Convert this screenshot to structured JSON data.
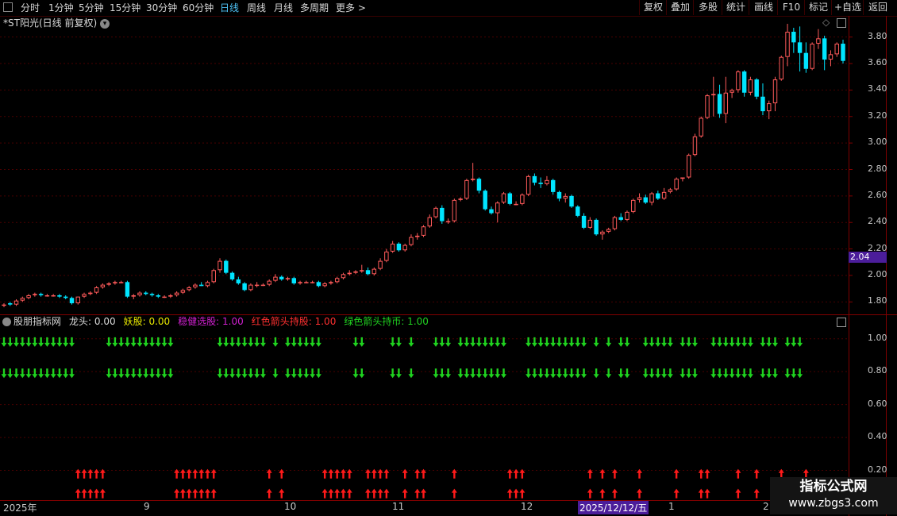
{
  "toolbar": {
    "periods": [
      "分时",
      "1分钟",
      "5分钟",
      "15分钟",
      "30分钟",
      "60分钟",
      "日线",
      "周线",
      "月线",
      "多周期",
      "更多 >"
    ],
    "active_period": "日线",
    "right_buttons": [
      "复权",
      "叠加",
      "多股",
      "统计",
      "画线",
      "F10",
      "标记",
      "+自选",
      "返回"
    ]
  },
  "chart_title": "*ST阳光(日线 前复权)",
  "price_axis": [
    "3.80",
    "3.60",
    "3.40",
    "3.20",
    "3.00",
    "2.80",
    "2.60",
    "2.40",
    "2.20",
    "2.00",
    "1.80"
  ],
  "current_price_tag": "2.04",
  "indicator": {
    "name": "股朋指标网",
    "items": [
      {
        "label": "龙头: 0.00",
        "color": "#d8d8d8"
      },
      {
        "label": "妖股: 0.00",
        "color": "#e6e600"
      },
      {
        "label": "稳健选股: 1.00",
        "color": "#d020d0"
      },
      {
        "label": "红色箭头持股: 1.00",
        "color": "#ff3030"
      },
      {
        "label": "绿色箭头持币: 1.00",
        "color": "#20d020"
      }
    ],
    "axis": [
      "1.00",
      "0.80",
      "0.60",
      "0.40",
      "0.20"
    ],
    "arrow_up_color": "#ff1a1a",
    "arrow_down_color": "#1fd21f"
  },
  "date_axis": {
    "labels": [
      "2025年",
      "9",
      "10",
      "11",
      "12",
      "1",
      "2"
    ],
    "selected_date": "2025/12/12/五"
  },
  "watermark": {
    "title": "指标公式网",
    "url": "www.zbgs3.com"
  },
  "colors": {
    "up": "#ff5a5a",
    "down": "#00e5ff",
    "grid": "#4a0000",
    "border": "#800000"
  },
  "chart_data": {
    "type": "candlestick",
    "ylim": [
      1.7,
      3.9
    ],
    "y_ticks": [
      1.8,
      2.0,
      2.2,
      2.4,
      2.6,
      2.8,
      3.0,
      3.2,
      3.4,
      3.6,
      3.8
    ],
    "ohlc": [
      [
        1.78,
        1.79,
        1.76,
        1.78
      ],
      [
        1.79,
        1.8,
        1.77,
        1.78
      ],
      [
        1.78,
        1.82,
        1.77,
        1.81
      ],
      [
        1.81,
        1.84,
        1.8,
        1.83
      ],
      [
        1.83,
        1.86,
        1.82,
        1.85
      ],
      [
        1.85,
        1.87,
        1.84,
        1.86
      ],
      [
        1.86,
        1.87,
        1.84,
        1.85
      ],
      [
        1.85,
        1.86,
        1.84,
        1.85
      ],
      [
        1.85,
        1.86,
        1.84,
        1.85
      ],
      [
        1.85,
        1.86,
        1.83,
        1.84
      ],
      [
        1.84,
        1.85,
        1.82,
        1.83
      ],
      [
        1.83,
        1.84,
        1.78,
        1.79
      ],
      [
        1.79,
        1.84,
        1.78,
        1.84
      ],
      [
        1.84,
        1.87,
        1.83,
        1.86
      ],
      [
        1.86,
        1.88,
        1.85,
        1.87
      ],
      [
        1.87,
        1.92,
        1.86,
        1.91
      ],
      [
        1.91,
        1.94,
        1.9,
        1.93
      ],
      [
        1.93,
        1.95,
        1.92,
        1.94
      ],
      [
        1.94,
        1.96,
        1.93,
        1.95
      ],
      [
        1.95,
        1.96,
        1.94,
        1.95
      ],
      [
        1.95,
        1.96,
        1.83,
        1.84
      ],
      [
        1.84,
        1.86,
        1.82,
        1.85
      ],
      [
        1.85,
        1.88,
        1.84,
        1.87
      ],
      [
        1.87,
        1.88,
        1.85,
        1.86
      ],
      [
        1.86,
        1.87,
        1.84,
        1.85
      ],
      [
        1.85,
        1.86,
        1.83,
        1.84
      ],
      [
        1.84,
        1.85,
        1.83,
        1.84
      ],
      [
        1.84,
        1.86,
        1.83,
        1.85
      ],
      [
        1.85,
        1.88,
        1.84,
        1.87
      ],
      [
        1.87,
        1.9,
        1.86,
        1.89
      ],
      [
        1.89,
        1.92,
        1.88,
        1.91
      ],
      [
        1.91,
        1.94,
        1.9,
        1.93
      ],
      [
        1.93,
        1.95,
        1.92,
        1.92
      ],
      [
        1.92,
        1.96,
        1.91,
        1.95
      ],
      [
        1.95,
        2.05,
        1.94,
        2.04
      ],
      [
        2.04,
        2.13,
        2.02,
        2.11
      ],
      [
        2.11,
        2.12,
        2.01,
        2.02
      ],
      [
        2.02,
        2.03,
        1.96,
        1.97
      ],
      [
        1.97,
        1.99,
        1.93,
        1.94
      ],
      [
        1.94,
        1.95,
        1.88,
        1.89
      ],
      [
        1.89,
        1.94,
        1.88,
        1.93
      ],
      [
        1.93,
        1.95,
        1.91,
        1.93
      ],
      [
        1.93,
        1.94,
        1.92,
        1.93
      ],
      [
        1.93,
        1.97,
        1.92,
        1.96
      ],
      [
        1.96,
        2.01,
        1.95,
        1.99
      ],
      [
        1.99,
        2.0,
        1.96,
        1.97
      ],
      [
        1.97,
        1.99,
        1.96,
        1.98
      ],
      [
        1.98,
        1.99,
        1.93,
        1.94
      ],
      [
        1.94,
        1.96,
        1.93,
        1.95
      ],
      [
        1.95,
        1.96,
        1.94,
        1.95
      ],
      [
        1.95,
        1.96,
        1.94,
        1.95
      ],
      [
        1.95,
        1.96,
        1.91,
        1.92
      ],
      [
        1.92,
        1.95,
        1.91,
        1.94
      ],
      [
        1.94,
        1.96,
        1.93,
        1.95
      ],
      [
        1.95,
        1.99,
        1.94,
        1.98
      ],
      [
        1.98,
        2.02,
        1.97,
        2.01
      ],
      [
        2.01,
        2.04,
        2.0,
        2.02
      ],
      [
        2.02,
        2.04,
        2.01,
        2.03
      ],
      [
        2.03,
        2.08,
        2.02,
        2.04
      ],
      [
        2.04,
        2.06,
        2.0,
        2.01
      ],
      [
        2.01,
        2.06,
        2.0,
        2.05
      ],
      [
        2.05,
        2.13,
        2.04,
        2.11
      ],
      [
        2.11,
        2.2,
        2.1,
        2.18
      ],
      [
        2.18,
        2.26,
        2.17,
        2.24
      ],
      [
        2.24,
        2.25,
        2.18,
        2.19
      ],
      [
        2.19,
        2.24,
        2.18,
        2.23
      ],
      [
        2.23,
        2.31,
        2.22,
        2.29
      ],
      [
        2.29,
        2.32,
        2.27,
        2.3
      ],
      [
        2.3,
        2.38,
        2.29,
        2.37
      ],
      [
        2.37,
        2.46,
        2.36,
        2.44
      ],
      [
        2.44,
        2.52,
        2.43,
        2.51
      ],
      [
        2.51,
        2.53,
        2.39,
        2.41
      ],
      [
        2.41,
        2.43,
        2.39,
        2.41
      ],
      [
        2.41,
        2.58,
        2.4,
        2.57
      ],
      [
        2.57,
        2.59,
        2.56,
        2.58
      ],
      [
        2.58,
        2.73,
        2.57,
        2.72
      ],
      [
        2.72,
        2.85,
        2.71,
        2.73
      ],
      [
        2.73,
        2.74,
        2.62,
        2.64
      ],
      [
        2.64,
        2.65,
        2.49,
        2.5
      ],
      [
        2.5,
        2.52,
        2.46,
        2.47
      ],
      [
        2.47,
        2.56,
        2.4,
        2.55
      ],
      [
        2.55,
        2.63,
        2.54,
        2.62
      ],
      [
        2.62,
        2.63,
        2.53,
        2.54
      ],
      [
        2.54,
        2.56,
        2.53,
        2.54
      ],
      [
        2.54,
        2.62,
        2.53,
        2.61
      ],
      [
        2.61,
        2.76,
        2.6,
        2.75
      ],
      [
        2.75,
        2.77,
        2.68,
        2.7
      ],
      [
        2.7,
        2.74,
        2.66,
        2.69
      ],
      [
        2.69,
        2.75,
        2.68,
        2.72
      ],
      [
        2.72,
        2.73,
        2.61,
        2.63
      ],
      [
        2.63,
        2.64,
        2.56,
        2.58
      ],
      [
        2.58,
        2.62,
        2.55,
        2.6
      ],
      [
        2.6,
        2.61,
        2.51,
        2.52
      ],
      [
        2.52,
        2.53,
        2.44,
        2.45
      ],
      [
        2.45,
        2.47,
        2.35,
        2.36
      ],
      [
        2.36,
        2.44,
        2.35,
        2.42
      ],
      [
        2.42,
        2.43,
        2.3,
        2.31
      ],
      [
        2.31,
        2.34,
        2.27,
        2.33
      ],
      [
        2.33,
        2.36,
        2.32,
        2.35
      ],
      [
        2.35,
        2.45,
        2.34,
        2.44
      ],
      [
        2.44,
        2.47,
        2.41,
        2.42
      ],
      [
        2.42,
        2.49,
        2.41,
        2.48
      ],
      [
        2.48,
        2.58,
        2.47,
        2.57
      ],
      [
        2.57,
        2.62,
        2.55,
        2.59
      ],
      [
        2.59,
        2.61,
        2.54,
        2.55
      ],
      [
        2.55,
        2.63,
        2.53,
        2.62
      ],
      [
        2.62,
        2.64,
        2.57,
        2.58
      ],
      [
        2.58,
        2.66,
        2.57,
        2.63
      ],
      [
        2.63,
        2.66,
        2.62,
        2.65
      ],
      [
        2.65,
        2.74,
        2.64,
        2.73
      ],
      [
        2.73,
        2.74,
        2.71,
        2.74
      ],
      [
        2.74,
        2.92,
        2.73,
        2.91
      ],
      [
        2.91,
        3.07,
        2.9,
        3.05
      ],
      [
        3.05,
        3.2,
        3.04,
        3.19
      ],
      [
        3.19,
        3.37,
        3.18,
        3.36
      ],
      [
        3.36,
        3.5,
        3.2,
        3.37
      ],
      [
        3.37,
        3.44,
        3.19,
        3.22
      ],
      [
        3.22,
        3.5,
        3.15,
        3.38
      ],
      [
        3.38,
        3.41,
        3.34,
        3.4
      ],
      [
        3.4,
        3.55,
        3.38,
        3.54
      ],
      [
        3.54,
        3.55,
        3.35,
        3.38
      ],
      [
        3.38,
        3.5,
        3.36,
        3.48
      ],
      [
        3.48,
        3.49,
        3.33,
        3.35
      ],
      [
        3.35,
        3.45,
        3.21,
        3.24
      ],
      [
        3.24,
        3.32,
        3.18,
        3.3
      ],
      [
        3.3,
        3.5,
        3.24,
        3.48
      ],
      [
        3.48,
        3.66,
        3.47,
        3.65
      ],
      [
        3.65,
        3.9,
        3.58,
        3.84
      ],
      [
        3.84,
        3.87,
        3.68,
        3.76
      ],
      [
        3.76,
        3.88,
        3.54,
        3.68
      ],
      [
        3.68,
        3.76,
        3.53,
        3.56
      ],
      [
        3.56,
        3.76,
        3.55,
        3.75
      ],
      [
        3.75,
        3.86,
        3.71,
        3.79
      ],
      [
        3.79,
        3.81,
        3.55,
        3.63
      ],
      [
        3.63,
        3.7,
        3.58,
        3.67
      ],
      [
        3.67,
        3.76,
        3.65,
        3.75
      ],
      [
        3.75,
        3.78,
        3.6,
        3.62
      ]
    ],
    "indicator_ylim": [
      0.0,
      1.1
    ],
    "down_arrows_y": [
      0.98,
      0.79
    ],
    "up_arrows_y": [
      0.18,
      0.06
    ],
    "down_arrow_bars": [
      0,
      1,
      2,
      3,
      4,
      5,
      6,
      7,
      8,
      9,
      10,
      11,
      17,
      18,
      19,
      20,
      21,
      22,
      23,
      24,
      25,
      26,
      27,
      35,
      36,
      37,
      38,
      39,
      40,
      41,
      42,
      44,
      46,
      47,
      48,
      49,
      50,
      51,
      57,
      58,
      63,
      64,
      66,
      70,
      71,
      72,
      74,
      75,
      76,
      77,
      78,
      79,
      80,
      81,
      85,
      86,
      87,
      88,
      89,
      90,
      91,
      92,
      93,
      94,
      96,
      98,
      100,
      101,
      104,
      105,
      106,
      107,
      108,
      110,
      111,
      112,
      115,
      116,
      117,
      118,
      119,
      120,
      121,
      123,
      124,
      125,
      127,
      128,
      129
    ],
    "up_arrow_bars": [
      12,
      13,
      14,
      15,
      16,
      28,
      29,
      30,
      31,
      32,
      33,
      34,
      43,
      45,
      52,
      53,
      54,
      55,
      56,
      59,
      60,
      61,
      62,
      65,
      67,
      68,
      73,
      82,
      83,
      84,
      95,
      97,
      99,
      103,
      109,
      113,
      114,
      119,
      122,
      126,
      130
    ]
  }
}
